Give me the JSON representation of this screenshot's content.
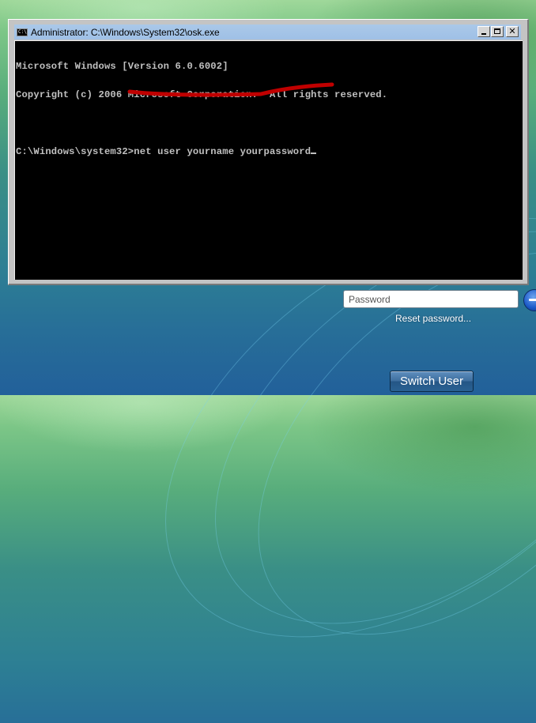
{
  "window": {
    "title": "Administrator: C:\\Windows\\System32\\osk.exe",
    "icon": "console-icon",
    "icon_text": "C:\\",
    "controls": {
      "minimize": "minimize",
      "maximize": "maximize",
      "close": "✕"
    }
  },
  "console": {
    "lines": [
      "Microsoft Windows [Version 6.0.6002]",
      "Copyright (c) 2006 Microsoft Corporation.  All rights reserved.",
      "",
      "C:\\Windows\\system32>net user yourname yourpassword"
    ],
    "annotation_color": "#c00000"
  },
  "login": {
    "password_placeholder": "Password",
    "password_value": "",
    "submit_icon": "arrow-right-icon",
    "reset_link": "Reset password...",
    "switch_user": "Switch User"
  }
}
